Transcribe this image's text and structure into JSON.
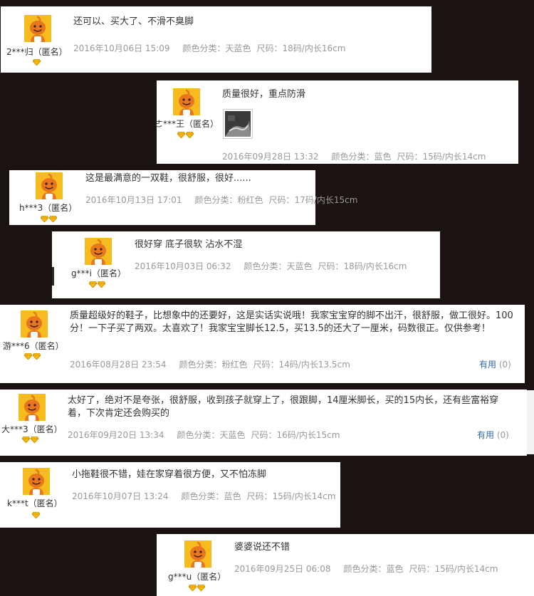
{
  "labels": {
    "color_prefix": "颜色分类：",
    "size_prefix": "尺码：",
    "useful": "有用",
    "anonymous": "（匿名）"
  },
  "reviews": [
    {
      "user": "2***归（匿名）",
      "text": "还可以、买大了、不滑不臭脚",
      "date": "2016年10月06日 15:09",
      "color": "天蓝色",
      "size": "18码/内长16cm"
    },
    {
      "user": "ㄜ***王（匿名）",
      "text": "质量很好，重点防滑",
      "date": "2016年09月28日 13:32",
      "color": "蓝色",
      "size": "15码/内长14cm",
      "has_photo": true
    },
    {
      "user": "h***3（匿名）",
      "text": "这是最满意的一双鞋，很舒服，很好......",
      "date": "2016年10月13日 17:01",
      "color": "粉红色",
      "size": "17码/内长15cm"
    },
    {
      "user": "g***i（匿名）",
      "text": "很好穿 底子很软 沾水不湿",
      "date": "2016年10月03日 06:32",
      "color": "天蓝色",
      "size": "18码/内长16cm"
    },
    {
      "user": "游***6（匿名）",
      "text": "质量超级好的鞋子，比想象中的还要好，这是实话实说哦！我家宝宝穿的脚不出汗，很舒服，做工很好。100分！一下子买了两双。太喜欢了！我家宝宝脚长12.5，买13.5的还大了一厘米，码数很正。仅供参考！",
      "date": "2016年08月28日 23:54",
      "color": "粉红色",
      "size": "14码/内长13.5cm",
      "useful": "(0)"
    },
    {
      "user": "大***3（匿名）",
      "text": "太好了，绝对不是夸张，很舒服，收到孩子就穿上了，很跟脚，14厘米脚长，买的15内长，还有些富裕穿着，下次肯定还会购买的",
      "date": "2016年09月20日 13:34",
      "color": "天蓝色",
      "size": "16码/内长15cm",
      "useful": "(0)"
    },
    {
      "user": "k***t（匿名）",
      "text": "小拖鞋很不错，娃在家穿着很方便，又不怕冻脚",
      "date": "2016年10月07日 13:24",
      "color": "蓝色",
      "size": "15码/内长14cm"
    },
    {
      "user": "g***u（匿名）",
      "text": "婆婆说还不错",
      "date": "2016年09月25日 06:08",
      "color": "蓝色",
      "size": "15码/内长14cm"
    }
  ],
  "colors": {
    "background": "#1b1311",
    "avatar_bg": "#f6bb1f",
    "avatar_char": "#e8761e",
    "link": "#3366aa",
    "meta": "#999999",
    "badge": "#f5b80f"
  }
}
